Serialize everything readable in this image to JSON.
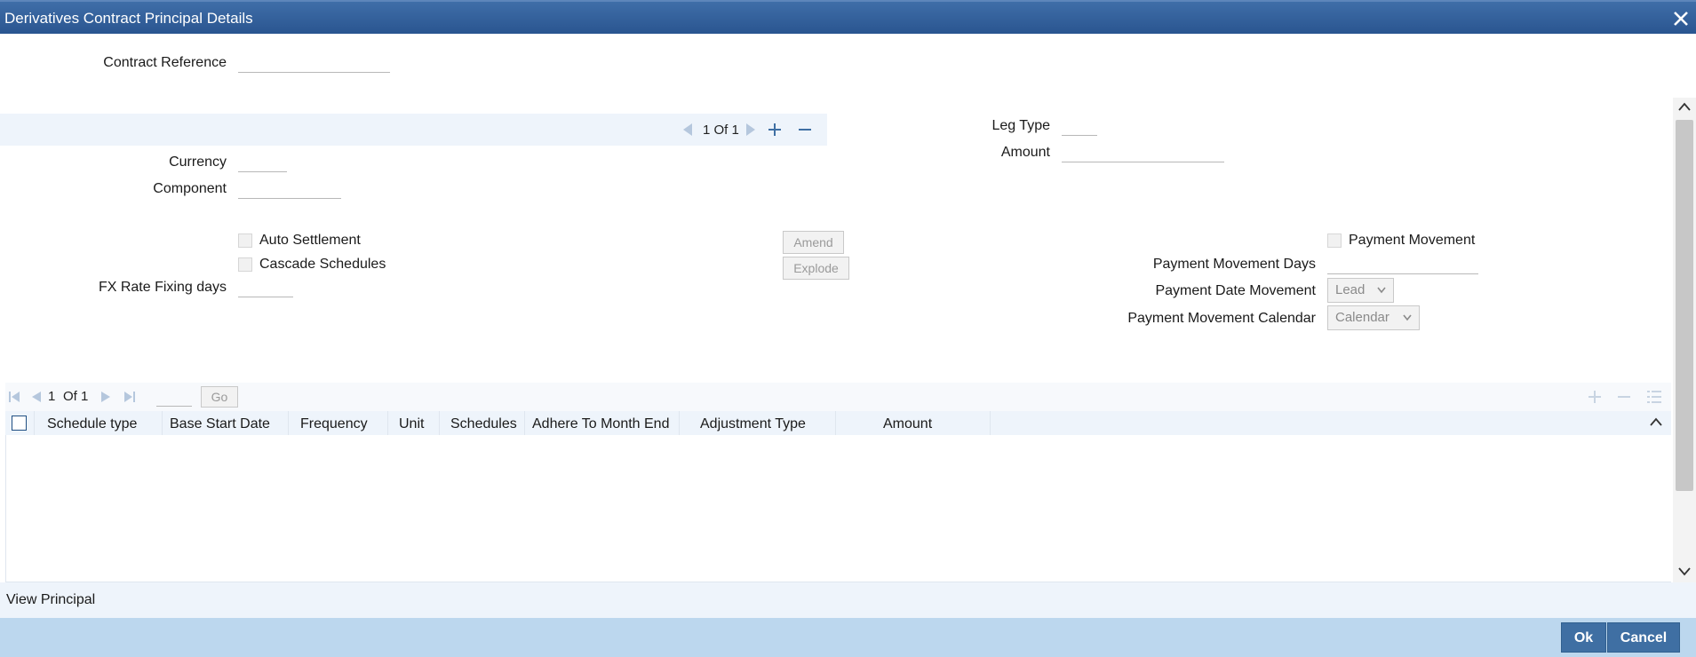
{
  "window": {
    "title": "Derivatives Contract Principal Details",
    "close_glyph": "✕"
  },
  "header": {
    "contract_reference_label": "Contract Reference",
    "contract_reference_value": ""
  },
  "leg_nav": {
    "page": "1 Of 1"
  },
  "fields": {
    "leg_type_label": "Leg Type",
    "leg_type_value": "",
    "amount_label": "Amount",
    "amount_value": "",
    "currency_label": "Currency",
    "currency_value": "",
    "component_label": "Component",
    "component_value": "",
    "auto_settlement_label": "Auto Settlement",
    "cascade_schedules_label": "Cascade Schedules",
    "fx_rate_fixing_days_label": "FX Rate Fixing days",
    "fx_rate_fixing_days_value": "",
    "amend_label": "Amend",
    "explode_label": "Explode",
    "payment_movement_label": "Payment Movement",
    "payment_movement_days_label": "Payment Movement Days",
    "payment_movement_days_value": "",
    "payment_date_movement_label": "Payment Date Movement",
    "payment_date_movement_value": "Lead",
    "payment_movement_calendar_label": "Payment Movement Calendar",
    "payment_movement_calendar_value": "Calendar"
  },
  "grid": {
    "page_current": "1",
    "page_of": "Of 1",
    "go_label": "Go",
    "page_input_value": "",
    "columns": [
      "Schedule type",
      "Base Start Date",
      "Frequency",
      "Unit",
      "Schedules",
      "Adhere To Month End",
      "Adjustment Type",
      "Amount"
    ]
  },
  "footer": {
    "view_principal_label": "View Principal",
    "ok_label": "Ok",
    "cancel_label": "Cancel"
  },
  "colors": {
    "title_bar": "#2f5d96",
    "band": "#eef4fb",
    "footer": "#bcd7ee",
    "button": "#3f6fa3"
  }
}
